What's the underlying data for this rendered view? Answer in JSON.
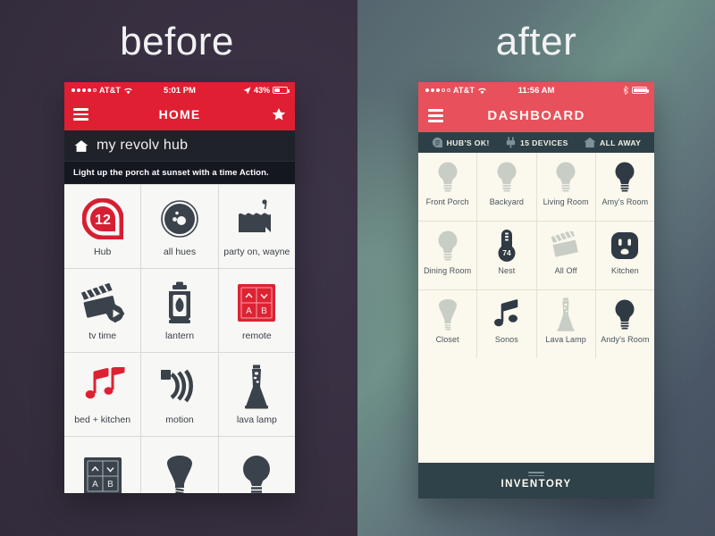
{
  "panels": {
    "before": {
      "title": "before",
      "bg": "#393044"
    },
    "after": {
      "title": "after",
      "bg": "#556670"
    }
  },
  "colors": {
    "before_accent": "#e01f32",
    "after_accent": "#e8505b",
    "after_infobar": "#2e4047",
    "after_paper": "#fbf8ed",
    "dark_ink": "#3a424b"
  },
  "before_phone": {
    "statusbar": {
      "signal_filled": 4,
      "signal_hollow": 1,
      "carrier": "AT&T",
      "wifi_icon": "wifi-icon",
      "time": "5:01 PM",
      "location_icon": "location-arrow-icon",
      "battery_percent": "43%",
      "battery_icon": "battery-icon"
    },
    "navbar": {
      "menu_icon": "hamburger-menu-icon",
      "title": "HOME",
      "favorite_icon": "star-icon"
    },
    "hub_row": {
      "home_icon": "home-icon",
      "name": "my revolv hub"
    },
    "tip_bar": {
      "text": "Light up the porch at sunset with a time Action."
    },
    "tiles": [
      {
        "label": "Hub",
        "icon": "hub-badge-icon"
      },
      {
        "label": "all hues",
        "icon": "hue-bulb-dial-icon"
      },
      {
        "label": "party on, wayne",
        "icon": "cake-icon"
      },
      {
        "label": "tv time",
        "icon": "clapperboard-gear-icon"
      },
      {
        "label": "lantern",
        "icon": "lantern-icon"
      },
      {
        "label": "remote",
        "icon": "remote-keypad-icon"
      },
      {
        "label": "bed + kitchen",
        "icon": "music-notes-icon"
      },
      {
        "label": "motion",
        "icon": "motion-sensor-icon"
      },
      {
        "label": "lava lamp",
        "icon": "lava-lamp-icon"
      },
      {
        "label": "",
        "icon": "remote-keypad-dark-icon"
      },
      {
        "label": "",
        "icon": "flood-bulb-icon"
      },
      {
        "label": "",
        "icon": "light-bulb-icon"
      }
    ],
    "hub_badge_number": "12",
    "remote_keys": [
      "⌃",
      "⌄",
      "A",
      "B"
    ]
  },
  "after_phone": {
    "statusbar": {
      "signal_filled": 3,
      "signal_hollow": 2,
      "carrier": "AT&T",
      "wifi_icon": "wifi-icon",
      "time": "11:56 AM",
      "bluetooth_icon": "bluetooth-icon",
      "battery_icon": "battery-icon"
    },
    "navbar": {
      "menu_icon": "hamburger-menu-icon",
      "title": "DASHBOARD"
    },
    "infobar": [
      {
        "label": "HUB'S OK!",
        "icon": "hub-status-icon"
      },
      {
        "label": "15 DEVICES",
        "icon": "plug-icon"
      },
      {
        "label": "ALL AWAY",
        "icon": "home-icon"
      }
    ],
    "tiles": [
      {
        "label": "Front Porch",
        "icon": "light-bulb-icon",
        "state": "off"
      },
      {
        "label": "Backyard",
        "icon": "light-bulb-icon",
        "state": "off"
      },
      {
        "label": "Living Room",
        "icon": "light-bulb-icon",
        "state": "off"
      },
      {
        "label": "Amy's Room",
        "icon": "light-bulb-icon",
        "state": "on"
      },
      {
        "label": "Dining Room",
        "icon": "light-bulb-icon",
        "state": "off"
      },
      {
        "label": "Nest",
        "icon": "thermostat-icon",
        "state": "on",
        "value": "74"
      },
      {
        "label": "All Off",
        "icon": "clapperboard-icon",
        "state": "off"
      },
      {
        "label": "Kitchen",
        "icon": "outlet-icon",
        "state": "on"
      },
      {
        "label": "Closet",
        "icon": "flood-bulb-icon",
        "state": "off"
      },
      {
        "label": "Sonos",
        "icon": "music-note-icon",
        "state": "on"
      },
      {
        "label": "Lava Lamp",
        "icon": "lava-lamp-icon",
        "state": "off"
      },
      {
        "label": "Andy's Room",
        "icon": "light-bulb-icon",
        "state": "on"
      }
    ],
    "footer": {
      "label": "INVENTORY",
      "grabber_icon": "drag-handle-icon"
    }
  }
}
